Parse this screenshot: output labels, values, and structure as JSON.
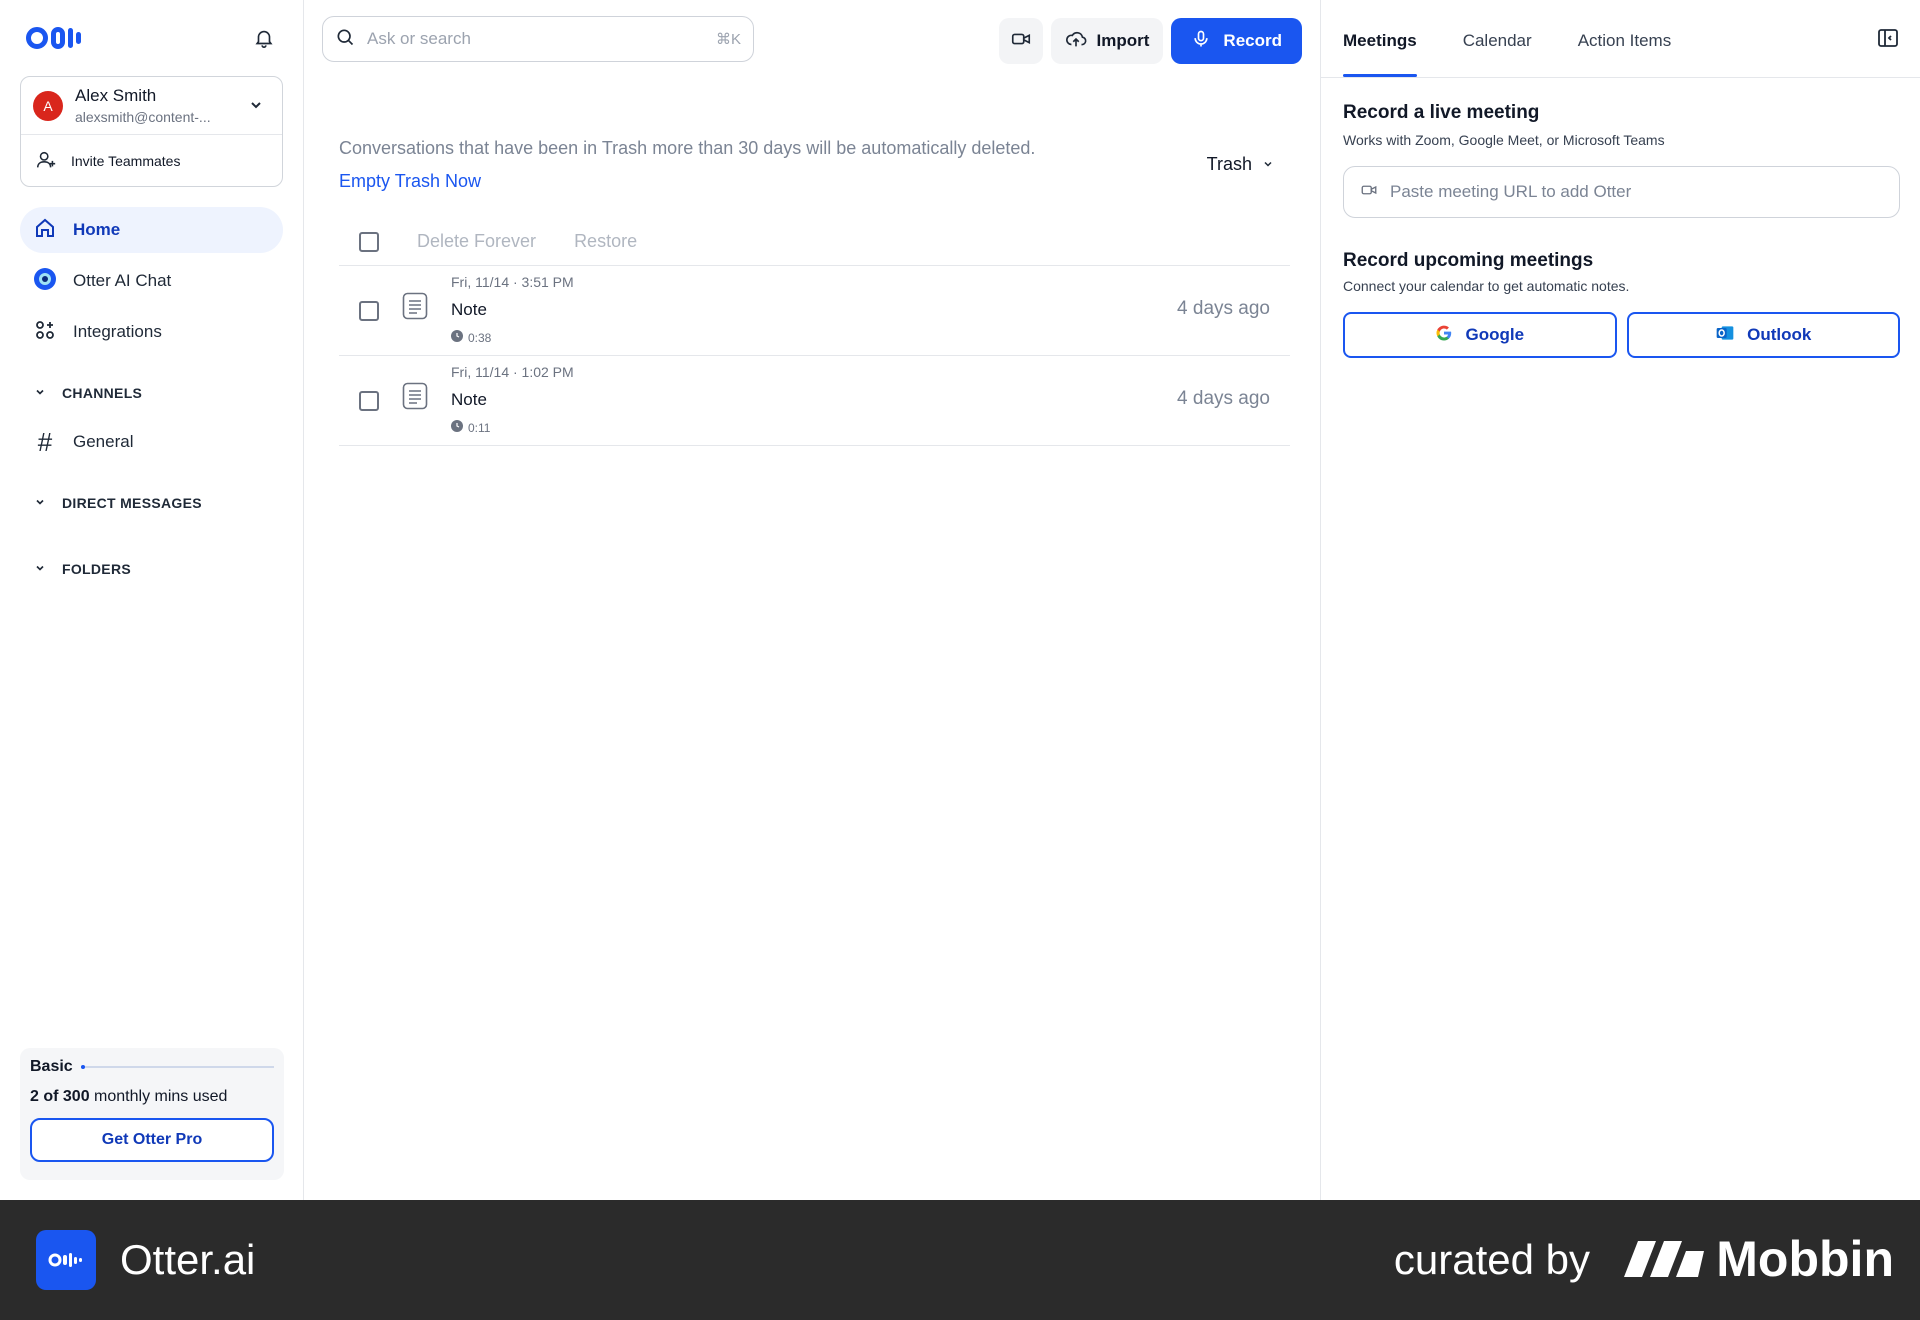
{
  "sidebar": {
    "account": {
      "avatar_initial": "A",
      "name": "Alex Smith",
      "email": "alexsmith@content-..."
    },
    "invite_label": "Invite Teammates",
    "nav": [
      {
        "label": "Home",
        "icon": "home-icon",
        "active": true
      },
      {
        "label": "Otter AI Chat",
        "icon": "otter-chat-icon"
      },
      {
        "label": "Integrations",
        "icon": "integrations-icon"
      }
    ],
    "sections": {
      "channels": "CHANNELS",
      "channel_general": "General",
      "direct_messages": "DIRECT MESSAGES",
      "folders": "FOLDERS"
    },
    "usage": {
      "plan": "Basic",
      "used": "2 of 300",
      "suffix": " monthly mins used",
      "fraction": 0.0067,
      "cta": "Get Otter Pro"
    }
  },
  "topbar": {
    "search_placeholder": "Ask or search",
    "search_shortcut": "⌘K",
    "import_label": "Import",
    "record_label": "Record"
  },
  "trash": {
    "notice": "Conversations that have been in Trash more than 30 days will be automatically deleted.",
    "empty_link": "Empty Trash Now",
    "filter": "Trash",
    "actions": {
      "delete": "Delete Forever",
      "restore": "Restore"
    },
    "items": [
      {
        "date": "Fri, 11/14 · 3:51 PM",
        "title": "Note",
        "duration": "0:38",
        "ago": "4 days ago"
      },
      {
        "date": "Fri, 11/14 · 1:02 PM",
        "title": "Note",
        "duration": "0:11",
        "ago": "4 days ago"
      }
    ]
  },
  "right_panel": {
    "tabs": [
      "Meetings",
      "Calendar",
      "Action Items"
    ],
    "live": {
      "title": "Record a live meeting",
      "subtitle": "Works with Zoom, Google Meet, or Microsoft Teams",
      "placeholder": "Paste meeting URL to add Otter"
    },
    "upcoming": {
      "title": "Record upcoming meetings",
      "subtitle": "Connect your calendar to get automatic notes.",
      "google": "Google",
      "outlook": "Outlook"
    }
  },
  "footer": {
    "app_name": "Otter.ai",
    "curated": "curated by",
    "brand": "Mobbin"
  },
  "colors": {
    "accent": "#1a56f0",
    "accent_dark": "#1039b8",
    "avatar": "#d9261c",
    "footer_bg": "#2b2b2b"
  }
}
